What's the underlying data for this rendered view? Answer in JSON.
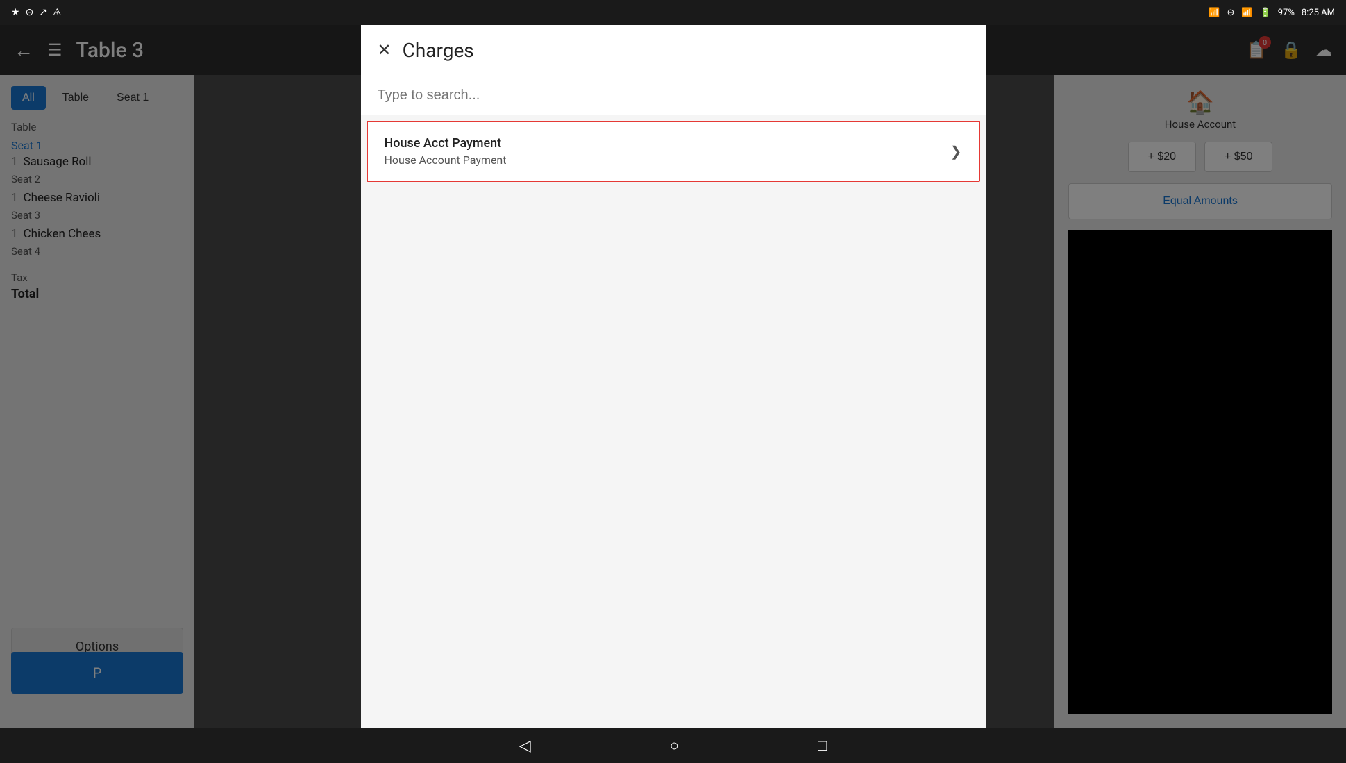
{
  "statusBar": {
    "leftIcons": [
      "bluetooth",
      "minus-circle",
      "wifi",
      "battery"
    ],
    "battery": "97%",
    "time": "8:25 AM"
  },
  "toolbar": {
    "title": "Table 3",
    "badgeCount": "0"
  },
  "tabs": {
    "items": [
      "All",
      "Table",
      "Seat 1"
    ]
  },
  "leftPanel": {
    "sections": [
      {
        "sectionLabel": "Table",
        "seats": [
          {
            "label": "Seat 1",
            "items": [
              {
                "qty": "1",
                "name": "Sausage Roll"
              }
            ]
          },
          {
            "label": "Seat 2",
            "items": [
              {
                "qty": "1",
                "name": "Cheese Ravioli"
              }
            ]
          },
          {
            "label": "Seat 3",
            "items": [
              {
                "qty": "1",
                "name": "Chicken Cheese"
              }
            ]
          },
          {
            "label": "Seat 4",
            "items": []
          }
        ]
      }
    ],
    "taxLabel": "Tax",
    "totalLabel": "Total",
    "optionsLabel": "Options",
    "payLabel": "P"
  },
  "rightPanel": {
    "houseAccountLabel": "House Account",
    "plus20Label": "+ $20",
    "plus50Label": "+ $50",
    "equalAmountsLabel": "Equal Amounts"
  },
  "dialog": {
    "title": "Charges",
    "searchPlaceholder": "Type to search...",
    "results": [
      {
        "primary": "House Acct Payment",
        "secondary": "House Account Payment"
      }
    ]
  },
  "bottomNav": {
    "back": "◁",
    "home": "○",
    "recent": "□"
  }
}
